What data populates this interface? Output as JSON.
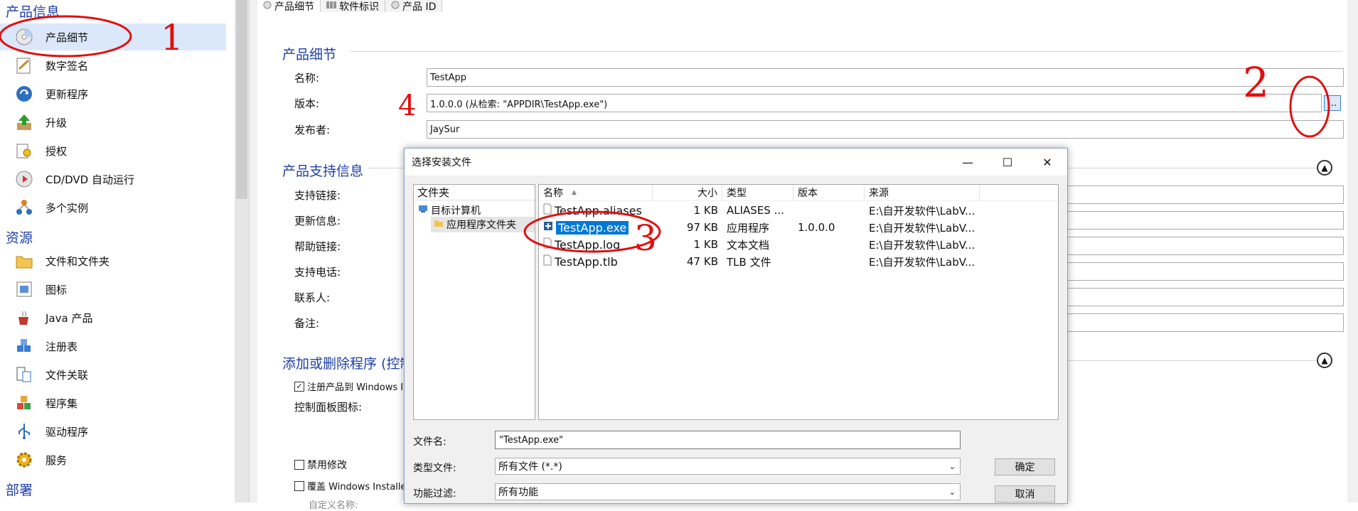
{
  "sidebar": {
    "section_product": "产品信息",
    "section_resources": "资源",
    "section_deploy": "部署",
    "items": [
      {
        "label": "产品细节",
        "icon": "cd-icon"
      },
      {
        "label": "数字签名",
        "icon": "signature-icon"
      },
      {
        "label": "更新程序",
        "icon": "update-icon"
      },
      {
        "label": "升级",
        "icon": "upgrade-arrow-icon"
      },
      {
        "label": "授权",
        "icon": "license-key-icon"
      },
      {
        "label": "CD/DVD 自动运行",
        "icon": "disc-autorun-icon"
      },
      {
        "label": "多个实例",
        "icon": "instances-icon"
      },
      {
        "label": "文件和文件夹",
        "icon": "folder-files-icon"
      },
      {
        "label": "图标",
        "icon": "icon-gallery-icon"
      },
      {
        "label": "Java 产品",
        "icon": "java-cup-icon"
      },
      {
        "label": "注册表",
        "icon": "registry-cubes-icon"
      },
      {
        "label": "文件关联",
        "icon": "file-association-icon"
      },
      {
        "label": "程序集",
        "icon": "assembly-icon"
      },
      {
        "label": "驱动程序",
        "icon": "usb-driver-icon"
      },
      {
        "label": "服务",
        "icon": "gear-service-icon"
      }
    ]
  },
  "tabs": [
    {
      "label": "产品细节",
      "icon": "cd-icon"
    },
    {
      "label": "软件标识",
      "icon": "barcode-icon"
    },
    {
      "label": "产品 ID",
      "icon": "id-icon"
    }
  ],
  "details": {
    "title": "产品细节",
    "name_label": "名称:",
    "name_value": "TestApp",
    "version_label": "版本:",
    "version_value": "1.0.0.0   (从检索: \"APPDIR\\TestApp.exe\")",
    "publisher_label": "发布者:",
    "publisher_value": "JaySur",
    "browse_label": "..."
  },
  "support": {
    "title": "产品支持信息",
    "labels": [
      "支持链接:",
      "更新信息:",
      "帮助链接:",
      "支持电话:",
      "联系人:",
      "备注:"
    ]
  },
  "addremove": {
    "title": "添加或删除程序 (控制",
    "register_label": "注册产品到 Windows I",
    "register_checked": true,
    "icon_label": "控制面板图标:",
    "disable_modify": "禁用修改",
    "override_label": "覆盖 Windows Installer",
    "custom_name": "自定义名称:"
  },
  "dialog": {
    "title": "选择安装文件",
    "folder_header": "文件夹",
    "tree": [
      "目标计算机",
      "应用程序文件夹"
    ],
    "columns": {
      "name": "名称",
      "size": "大小",
      "type": "类型",
      "version": "版本",
      "source": "来源"
    },
    "files": [
      {
        "name": "TestApp.aliases",
        "size": "1 KB",
        "type": "ALIASES ...",
        "version": "",
        "source": "E:\\自开发软件\\LabV...",
        "icon": "file-icon",
        "selected": false
      },
      {
        "name": "TestApp.exe",
        "size": "97 KB",
        "type": "应用程序",
        "version": "1.0.0.0",
        "source": "E:\\自开发软件\\LabV...",
        "icon": "exe-icon",
        "selected": true
      },
      {
        "name": "TestApp.log",
        "size": "1 KB",
        "type": "文本文档",
        "version": "",
        "source": "E:\\自开发软件\\LabV...",
        "icon": "file-icon",
        "selected": false
      },
      {
        "name": "TestApp.tlb",
        "size": "47 KB",
        "type": "TLB 文件",
        "version": "",
        "source": "E:\\自开发软件\\LabV...",
        "icon": "file-icon",
        "selected": false
      }
    ],
    "filename_label": "文件名:",
    "filename_value": "\"TestApp.exe\"",
    "filetype_label": "类型文件:",
    "filetype_value": "所有文件 (*.*)",
    "feature_label": "功能过滤:",
    "feature_value": "所有功能",
    "ok": "确定",
    "cancel": "取消"
  },
  "annotations": {
    "one": "1",
    "two": "2",
    "three": "3",
    "four": "4",
    "color": "#e01010"
  }
}
